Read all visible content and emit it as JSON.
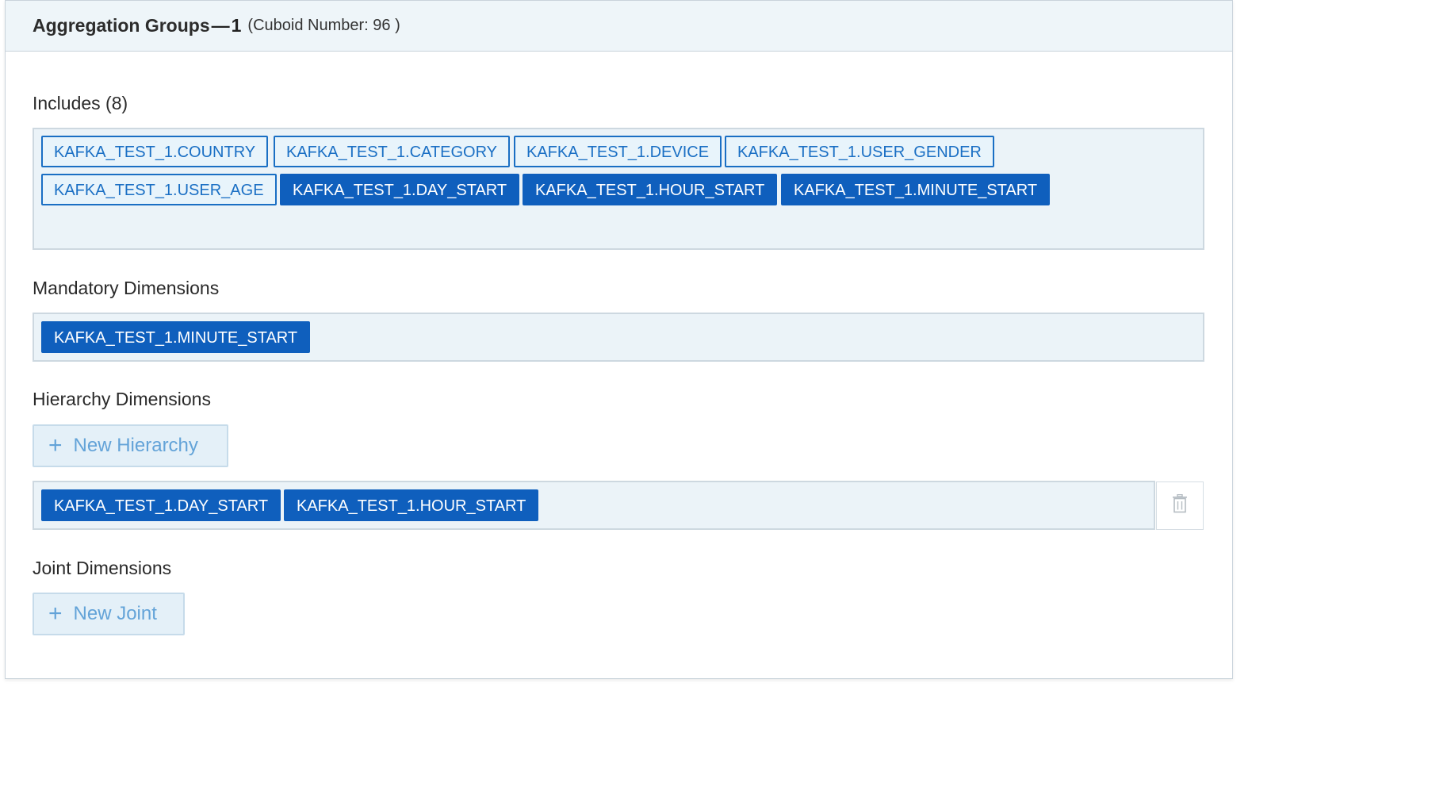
{
  "header": {
    "title": "Aggregation Groups",
    "dash": "—",
    "number": "1",
    "cuboid": "(Cuboid Number: 96 )"
  },
  "includes": {
    "label": "Includes (8)",
    "tags": [
      {
        "text": "KAFKA_TEST_1.COUNTRY",
        "selected": false
      },
      {
        "text": "KAFKA_TEST_1.CATEGORY",
        "selected": false
      },
      {
        "text": "KAFKA_TEST_1.DEVICE",
        "selected": false
      },
      {
        "text": "KAFKA_TEST_1.USER_GENDER",
        "selected": false
      },
      {
        "text": "KAFKA_TEST_1.USER_AGE",
        "selected": false
      },
      {
        "text": "KAFKA_TEST_1.DAY_START",
        "selected": true
      },
      {
        "text": "KAFKA_TEST_1.HOUR_START",
        "selected": true
      },
      {
        "text": "KAFKA_TEST_1.MINUTE_START",
        "selected": true
      }
    ]
  },
  "mandatory": {
    "label": "Mandatory Dimensions",
    "tags": [
      "KAFKA_TEST_1.MINUTE_START"
    ]
  },
  "hierarchy": {
    "label": "Hierarchy Dimensions",
    "new_button": "New Hierarchy",
    "plus": "+",
    "groups": [
      {
        "tags": [
          "KAFKA_TEST_1.DAY_START",
          "KAFKA_TEST_1.HOUR_START"
        ],
        "delete_icon": "trash-icon"
      }
    ]
  },
  "joint": {
    "label": "Joint Dimensions",
    "new_button": "New Joint",
    "plus": "+"
  },
  "colors": {
    "tag_selected": "#0f5fbd",
    "tag_unselected_text": "#1a6fc4",
    "box_bg": "#ebf3f8",
    "header_bg": "#eef5f9"
  }
}
